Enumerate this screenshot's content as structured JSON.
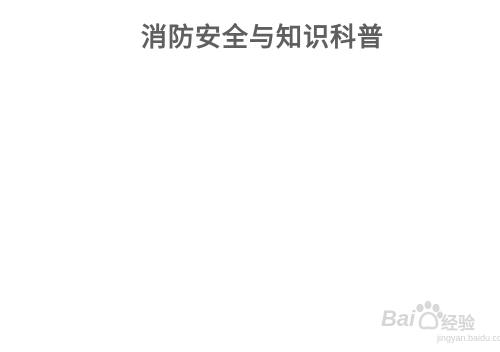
{
  "slide": {
    "title": "消防安全与知识科普"
  },
  "watermark": {
    "brand": "Bai",
    "brand_suffix": "",
    "product": "经验",
    "domain": "jingyan.baidu.com",
    "paw_icon": "baidu-paw-icon"
  }
}
